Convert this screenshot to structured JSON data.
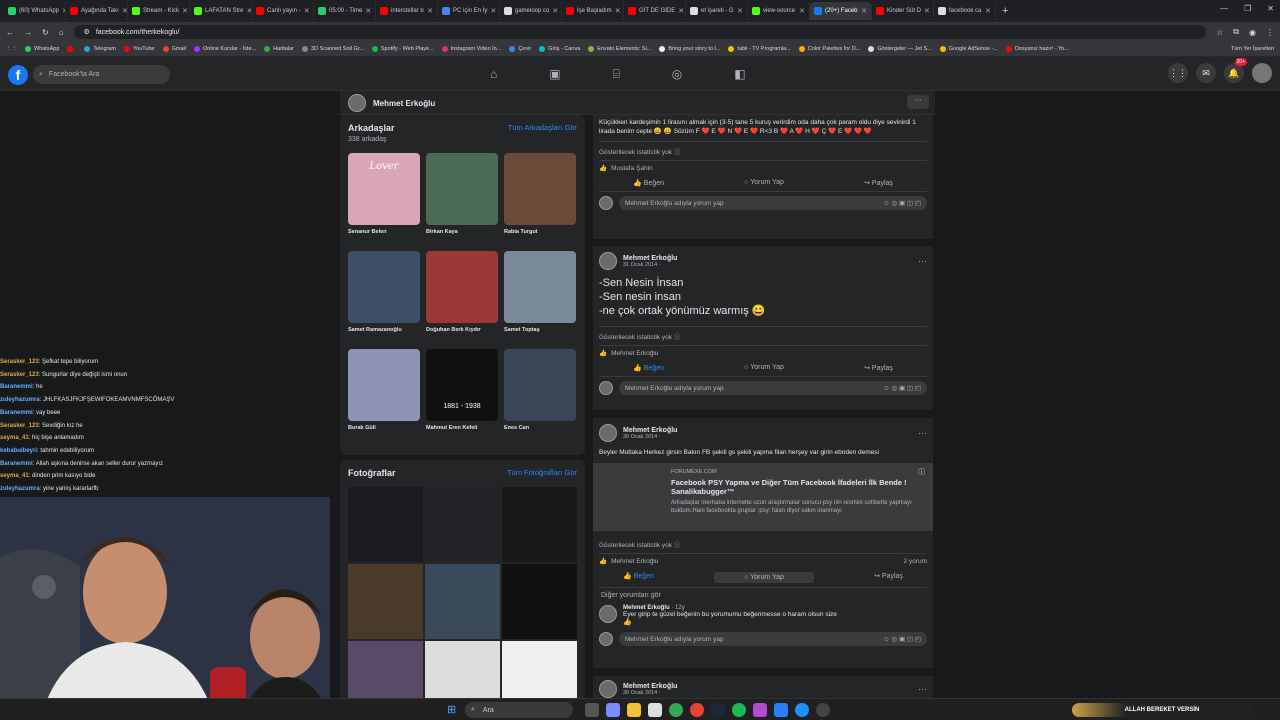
{
  "browser": {
    "tabs": [
      {
        "label": "(60) WhatsApp",
        "color": "#25d366"
      },
      {
        "label": "Ayağında Takı",
        "color": "#ff0000"
      },
      {
        "label": "Stream - Kick",
        "color": "#53fc18"
      },
      {
        "label": "LAFATAN Stre",
        "color": "#53fc18"
      },
      {
        "label": "Canlı yayın -",
        "color": "#ff0000"
      },
      {
        "label": "05:00 - Time",
        "color": "#2ecc71"
      },
      {
        "label": "interstellar b",
        "color": "#ff0000"
      },
      {
        "label": "PC için En İy",
        "color": "#4285f4"
      },
      {
        "label": "gameloop co",
        "color": "#dddddd"
      },
      {
        "label": "İşe Başladım",
        "color": "#ff0000"
      },
      {
        "label": "GİT DE GİDE",
        "color": "#ff0000"
      },
      {
        "label": "et işareti - G",
        "color": "#dddddd"
      },
      {
        "label": "view-source",
        "color": "#53fc18"
      },
      {
        "label": "(20+) Faceb",
        "color": "#1877f2"
      },
      {
        "label": "Kinder Süt D",
        "color": "#ff0000"
      },
      {
        "label": "facebook ca",
        "color": "#dddddd"
      }
    ],
    "active_tab": 13,
    "url": "facebook.com/therkekoglu/",
    "bookmarks": [
      {
        "label": "WhatsApp",
        "color": "#25d366"
      },
      {
        "label": "",
        "color": "#ff0000"
      },
      {
        "label": "Telegram",
        "color": "#2aa3e2"
      },
      {
        "label": "YouTube",
        "color": "#ff0000"
      },
      {
        "label": "Gmail",
        "color": "#ea4335"
      },
      {
        "label": "Online Kurslar - İste...",
        "color": "#a435f0"
      },
      {
        "label": "Haritalar",
        "color": "#34a853"
      },
      {
        "label": "3D Scanned Soil Gr...",
        "color": "#888888"
      },
      {
        "label": "Spotify - Web Playe...",
        "color": "#1db954"
      },
      {
        "label": "Instagram Video İn...",
        "color": "#e1306c"
      },
      {
        "label": "Çevir",
        "color": "#4285f4"
      },
      {
        "label": "Giriş - Canva",
        "color": "#00c4cc"
      },
      {
        "label": "Envato Elements: Si...",
        "color": "#82b541"
      },
      {
        "label": "Bring your story to l...",
        "color": "#eeeeee"
      },
      {
        "label": "tabii - TV Programla...",
        "color": "#f1c40f"
      },
      {
        "label": "Color Palettes for D...",
        "color": "#ffae00"
      },
      {
        "label": "Göstergeler — Jet S...",
        "color": "#dddddd"
      },
      {
        "label": "Google AdSense -...",
        "color": "#fbbc04"
      },
      {
        "label": "Dosyanız hazır! - Yo...",
        "color": "#ff0000"
      }
    ],
    "all_bookmarks": "Tüm Yer İşaretleri"
  },
  "facebook": {
    "logo": "f",
    "search_placeholder": "Facebook'ta Ara",
    "notif_badge": "20+",
    "profile_name": "Mehmet Erkoğlu",
    "friends": {
      "title": "Arkadaşlar",
      "count": "338 arkadaş",
      "see_all": "Tüm Arkadaşları Gör",
      "items": [
        {
          "name": "Senanur Belen",
          "color": "#d9a5b8"
        },
        {
          "name": "Birkan Kaya",
          "color": "#4c6b54"
        },
        {
          "name": "Rabia Turgut",
          "color": "#6b4a3a"
        },
        {
          "name": "Samet Ramazanoğlu",
          "color": "#3d4f66"
        },
        {
          "name": "Doğuhan Berk Kıydır",
          "color": "#9e3737"
        },
        {
          "name": "Samet Toptaş",
          "color": "#7a8a9a"
        },
        {
          "name": "Burak Güli",
          "color": "#8d94b5"
        },
        {
          "name": "Mahmut Eren Kefeli",
          "color": "#111111"
        },
        {
          "name": "Enes Can",
          "color": "#3a4558"
        }
      ],
      "photo_texts": [
        "Lover",
        "1881 - 1938"
      ]
    },
    "photos": {
      "title": "Fotoğraflar",
      "see_all": "Tüm Fotoğrafları Gör",
      "colors": [
        "#1a1c22",
        "#22242a",
        "#181818",
        "#4a3a2a",
        "#3a4a5a",
        "#101010",
        "#5a4a6a",
        "#dcdcdc",
        "#efefef"
      ]
    },
    "posts": [
      {
        "text": "Küçükken kardeşimin 1 lirasını almak için (3-5) tane 5 kuruş verirdim oda daha çok param oldu diye sevinirdi 1 lirada benim cepte 😀 😀 Sözüm F ❤️ E ❤️ N ❤️ E ❤️ R<3 B ❤️ A ❤️ H ❤️ Ç ❤️ E ❤️ ❤️ ❤️",
        "stat": "Gösterilecek istatistik yok",
        "liker": "Mustafa Şahin",
        "like": "Beğen",
        "comment": "Yorum Yap",
        "share": "Paylaş",
        "comment_placeholder": "Mehmet Erkoğlu adıyla yorum yap"
      },
      {
        "author": "Mehmet Erkoğlu",
        "date": "31 Ocak 2014 ·",
        "lines": [
          "-Sen Nesin İnsan",
          "-Sen nesin insan",
          "-ne çok ortak yönümüz warmış 😀"
        ],
        "stat": "Gösterilecek istatistik yok",
        "liker": "Mehmet Erkoğlu",
        "like": "Beğen",
        "comment": "Yorum Yap",
        "share": "Paylaş",
        "comment_placeholder": "Mehmet Erkoğlu adıyla yorum yap"
      },
      {
        "author": "Mehmet Erkoğlu",
        "date": "30 Ocak 2014 ·",
        "text": "Beyler Mutlaka Herkez girsin Bakın FB şekili gs şekili yapma filan herşey var girin ebnden demesi",
        "link_domain": "FORUMEXE.COM",
        "link_title": "Facebook PSY Yapma ve Diğer Tüm Facebook İfadeleri İlk Bende ! Sanalikabugger™",
        "link_desc": "Arkadaşlar merhaba internette uzun araştırmalar sonucu psy nin resmini sohbette yapmayı buldum.Hani facebookta gruplar :psy: falan diyor sakın inanmayı",
        "stat": "Gösterilecek istatistik yok",
        "liker": "Mehmet Erkoğlu",
        "comments_count": "2 yorum",
        "like": "Beğen",
        "comment": "Yorum Yap",
        "share": "Paylaş",
        "other_comments": "Diğer yorumları gör",
        "reply_author": "Mehmet Erkoğlu",
        "reply_time": "· 12y",
        "reply_text": "Eyer girip te güzel beğenin bu yorumumu beğenmesse o haram olsun size",
        "comment_placeholder": "Mehmet Erkoğlu adıyla yorum yap"
      },
      {
        "author": "Mehmet Erkoğlu",
        "date": "30 Ocak 2014 ·"
      }
    ]
  },
  "chat": [
    {
      "user": "Serasker_123",
      "msg": ": Şefkat tepe biliyorum",
      "c": "u"
    },
    {
      "user": "Serasker_123",
      "msg": ": Sungurlar diye değişti ismi onun",
      "c": "u"
    },
    {
      "user": "Baranemmi",
      "msg": ": he",
      "c": "u2"
    },
    {
      "user": "zuleyhazumra",
      "msg": ": JHLFKASJFKJFŞEWIFOKEAMVNMFSCÖMAŞV",
      "c": "u2"
    },
    {
      "user": "Baranemmi",
      "msg": ": vay beee",
      "c": "u2"
    },
    {
      "user": "Serasker_123",
      "msg": ": Sevdiğin kız he",
      "c": "u"
    },
    {
      "user": "seyma_41",
      "msg": ": hiç bişe anlamadım",
      "c": "u"
    },
    {
      "user": "kebabuibeyri",
      "msg": ": tahmin edebiliyorum",
      "c": "u2"
    },
    {
      "user": "Baranemmi",
      "msg": ": Allah aşkına denirse akan seller durur yazmayız",
      "c": "u2"
    },
    {
      "user": "seyma_41",
      "msg": ": dinden prim kasıyo bide",
      "c": "u"
    },
    {
      "user": "zuleyhazumra",
      "msg": ": yine yanlış kararlarfb",
      "c": "u2"
    }
  ],
  "taskbar": {
    "search": "Ara",
    "ticker": "ALLAH BEREKET VERSİN"
  }
}
